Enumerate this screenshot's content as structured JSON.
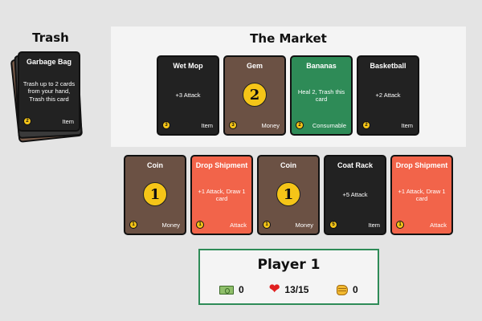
{
  "trash": {
    "title": "Trash",
    "top_card": {
      "name": "Garbage Bag",
      "text": "Trash up to 2 cards from your hand, Trash this card",
      "cost": "2",
      "type": "Item"
    }
  },
  "market": {
    "title": "The Market",
    "row1": [
      {
        "name": "Wet Mop",
        "text": "+3 Attack",
        "cost": "3",
        "type": "Item",
        "color": "#222222"
      },
      {
        "name": "Gem",
        "big": "2",
        "cost": "3",
        "type": "Money",
        "color": "#6b5144"
      },
      {
        "name": "Bananas",
        "text": "Heal 2, Trash this card",
        "cost": "2",
        "type": "Consumable",
        "color": "#2e8b57"
      },
      {
        "name": "Basketball",
        "text": "+2 Attack",
        "cost": "2",
        "type": "Item",
        "color": "#222222"
      }
    ],
    "row2": [
      {
        "name": "Coin",
        "big": "1",
        "cost": "1",
        "type": "Money",
        "color": "#6b5144"
      },
      {
        "name": "Drop Shipment",
        "text": "+1 Attack, Draw 1 card",
        "cost": "1",
        "type": "Attack",
        "color": "#f2644a"
      },
      {
        "name": "Coin",
        "big": "1",
        "cost": "1",
        "type": "Money",
        "color": "#6b5144"
      },
      {
        "name": "Coat Rack",
        "text": "+5 Attack",
        "cost": "5",
        "type": "Item",
        "color": "#222222"
      },
      {
        "name": "Drop Shipment",
        "text": "+1 Attack, Draw 1 card",
        "cost": "1",
        "type": "Attack",
        "color": "#f2644a"
      }
    ]
  },
  "player": {
    "name": "Player 1",
    "money": "0",
    "health": "13/15",
    "attack": "0",
    "icons": {
      "money": "money-icon",
      "health": "heart-icon",
      "attack": "fist-icon"
    }
  }
}
